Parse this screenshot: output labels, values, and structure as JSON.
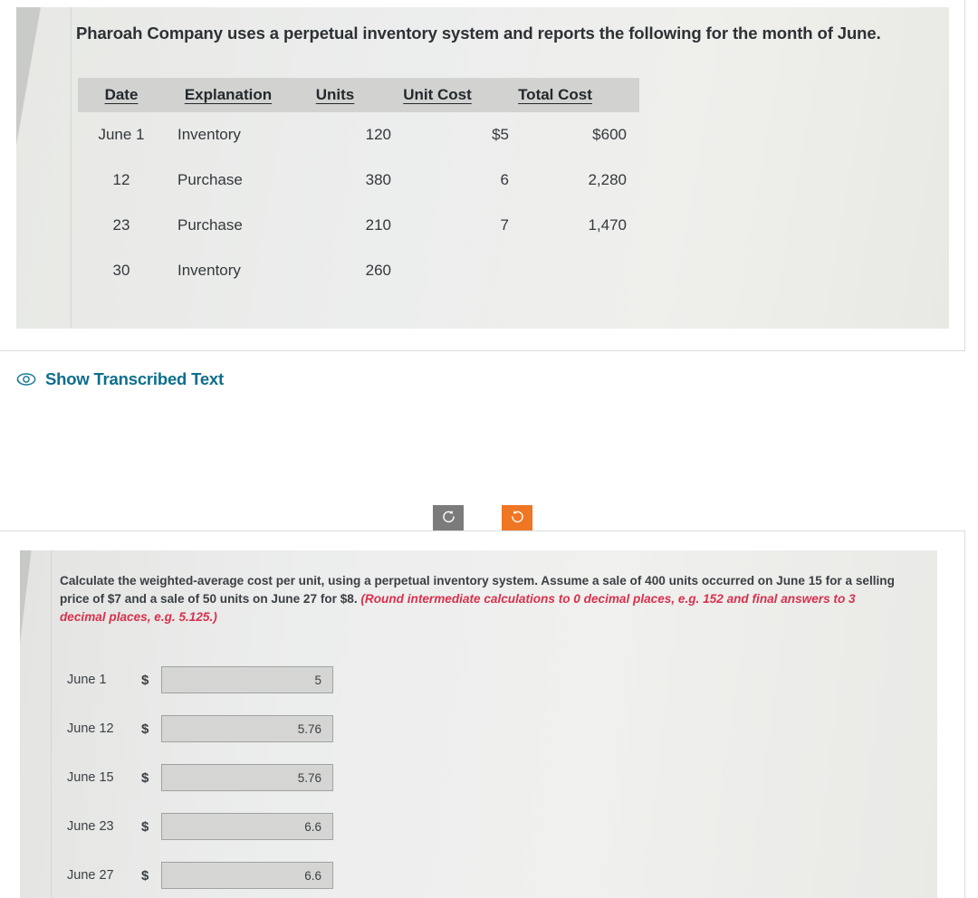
{
  "question": {
    "title": "Pharoah Company uses a perpetual inventory system and reports the following for the month of June.",
    "table": {
      "headers": [
        "Date",
        "Explanation",
        "Units",
        "Unit Cost",
        "Total Cost"
      ],
      "rows": [
        {
          "date": "June 1",
          "explanation": "Inventory",
          "units": "120",
          "unit_cost": "$5",
          "total_cost": "$600"
        },
        {
          "date": "12",
          "explanation": "Purchase",
          "units": "380",
          "unit_cost": "6",
          "total_cost": "2,280"
        },
        {
          "date": "23",
          "explanation": "Purchase",
          "units": "210",
          "unit_cost": "7",
          "total_cost": "1,470"
        },
        {
          "date": "30",
          "explanation": "Inventory",
          "units": "260",
          "unit_cost": "",
          "total_cost": ""
        }
      ]
    }
  },
  "transcribe": {
    "label": "Show Transcribed Text",
    "icon": "eye-icon",
    "color": "#0d6e8c"
  },
  "rotate_controls": {
    "rotate_left": {
      "icon": "rotate-counter-clockwise-icon",
      "color": "#7b7b7b"
    },
    "rotate_right": {
      "icon": "rotate-clockwise-icon",
      "color": "#ef7622"
    }
  },
  "answer_panel": {
    "instructions_plain_1": "Calculate the weighted-average cost per unit, using a perpetual inventory system. Assume a sale of 400 units occurred on June 15 for a selling price of $7 and a sale of 50 units on June 27 for $8. ",
    "instructions_emphasis": "(Round intermediate calculations to 0 decimal places, e.g. 152 and final answers to 3 decimal places, e.g. 5.125.)",
    "currency_symbol": "$",
    "rows": [
      {
        "label": "June 1",
        "value": "5"
      },
      {
        "label": "June 12",
        "value": "5.76"
      },
      {
        "label": "June 15",
        "value": "5.76"
      },
      {
        "label": "June 23",
        "value": "6.6"
      },
      {
        "label": "June 27",
        "value": "6.6"
      }
    ]
  }
}
